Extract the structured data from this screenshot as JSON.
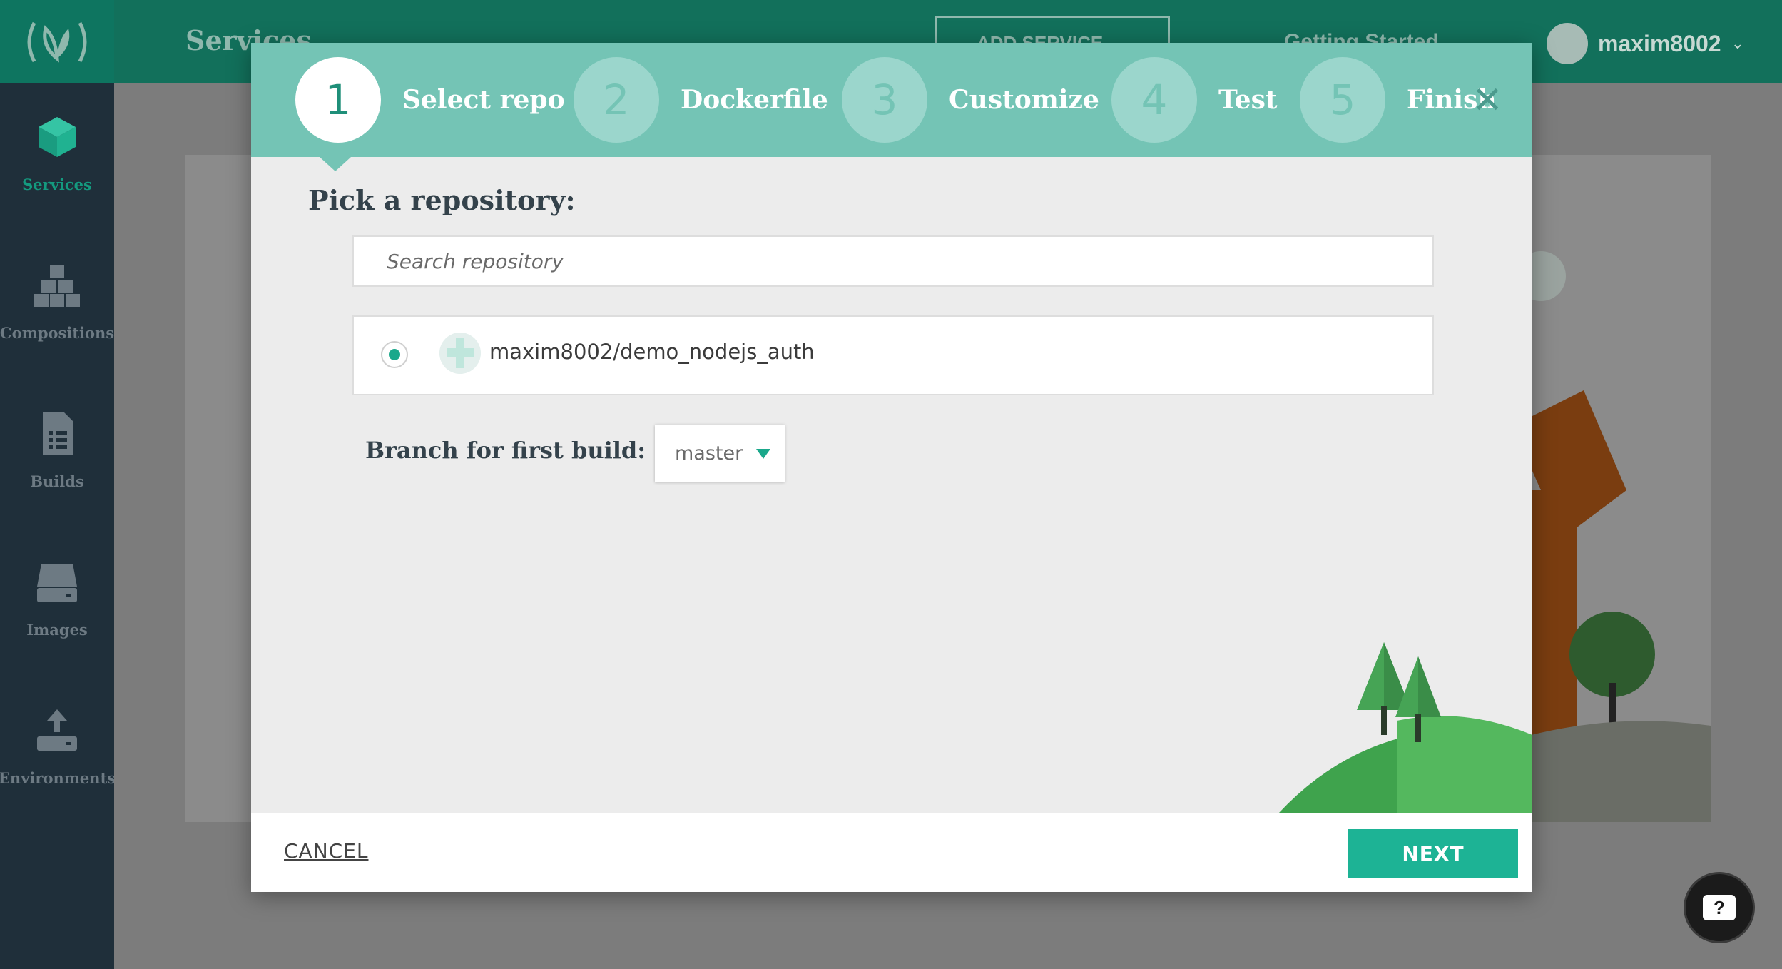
{
  "app": {
    "page_title": "Services",
    "add_service_label": "ADD SERVICE",
    "getting_started_label": "Getting Started",
    "user": {
      "name": "maxim8002"
    }
  },
  "sidebar": {
    "items": [
      {
        "label": "Services",
        "icon": "cube-icon"
      },
      {
        "label": "Compositions",
        "icon": "cubes-icon"
      },
      {
        "label": "Builds",
        "icon": "document-icon"
      },
      {
        "label": "Images",
        "icon": "drive-icon"
      },
      {
        "label": "Environments",
        "icon": "upload-icon"
      }
    ]
  },
  "wizard": {
    "steps": [
      {
        "number": "1",
        "label": "Select repo"
      },
      {
        "number": "2",
        "label": "Dockerfile"
      },
      {
        "number": "3",
        "label": "Customize"
      },
      {
        "number": "4",
        "label": "Test"
      },
      {
        "number": "5",
        "label": "Finish"
      }
    ],
    "active_step": 1,
    "section_title": "Pick a repository:",
    "search": {
      "placeholder": "Search repository",
      "value": ""
    },
    "repositories": [
      {
        "name": "maxim8002/demo_nodejs_auth",
        "selected": true
      }
    ],
    "branch": {
      "label": "Branch for first build:",
      "value": "master"
    },
    "cancel_label": "CANCEL",
    "next_label": "NEXT"
  },
  "help": {
    "glyph": "?"
  },
  "colors": {
    "accent": "#1db395",
    "stepper": "#74c4b5",
    "topbar": "#12705b",
    "sidebar": "#1f2f3a"
  }
}
